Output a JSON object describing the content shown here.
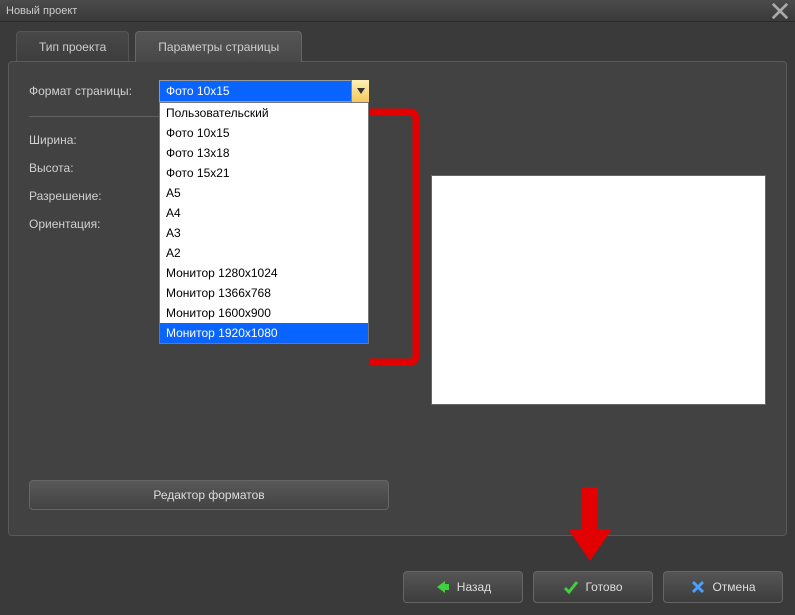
{
  "window": {
    "title": "Новый проект"
  },
  "tabs": {
    "project_type": "Тип проекта",
    "page_params": "Параметры страницы"
  },
  "form": {
    "page_format_label": "Формат страницы:",
    "width_label": "Ширина:",
    "height_label": "Высота:",
    "resolution_label": "Разрешение:",
    "orientation_label": "Ориентация:"
  },
  "combo": {
    "selected": "Фото 10x15",
    "options": [
      "Пользовательский",
      "Фото 10x15",
      "Фото 13x18",
      "Фото 15x21",
      "A5",
      "A4",
      "A3",
      "A2",
      "Монитор 1280x1024",
      "Монитор 1366x768",
      "Монитор 1600x900",
      "Монитор 1920x1080"
    ],
    "hovered_index": 11
  },
  "buttons": {
    "format_editor": "Редактор форматов",
    "back": "Назад",
    "done": "Готово",
    "cancel": "Отмена"
  }
}
